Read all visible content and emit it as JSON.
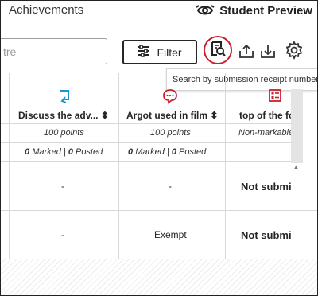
{
  "header": {
    "title": "Achievements",
    "student_preview_label": "Student Preview"
  },
  "toolbar": {
    "search_placeholder": "tre",
    "filter_label": "Filter",
    "tooltip": "Search by submission receipt number"
  },
  "columns": [
    {
      "name": "Discuss the adv...",
      "icon": "discussion-icon",
      "points": "100 points",
      "marked_count": "0",
      "marked_label": "Marked",
      "posted_count": "0",
      "posted_label": "Posted",
      "sort": true,
      "icon_color": "#1a93d6"
    },
    {
      "name": "Argot used in film",
      "icon": "chat-bubble-icon",
      "points": "100 points",
      "marked_count": "0",
      "marked_label": "Marked",
      "posted_count": "0",
      "posted_label": "Posted",
      "sort": true,
      "icon_color": "#c8202c"
    },
    {
      "name": "top of the fo",
      "icon": "test-icon",
      "points": "Non-markable",
      "icon_color": "#c8202c"
    }
  ],
  "rows": [
    {
      "cells": [
        "-",
        "-",
        "Not submi"
      ]
    },
    {
      "cells": [
        "-",
        "Exempt",
        "Not submi"
      ]
    }
  ],
  "separator": "|",
  "colors": {
    "accent_red": "#c8202c",
    "accent_blue": "#1a93d6"
  }
}
